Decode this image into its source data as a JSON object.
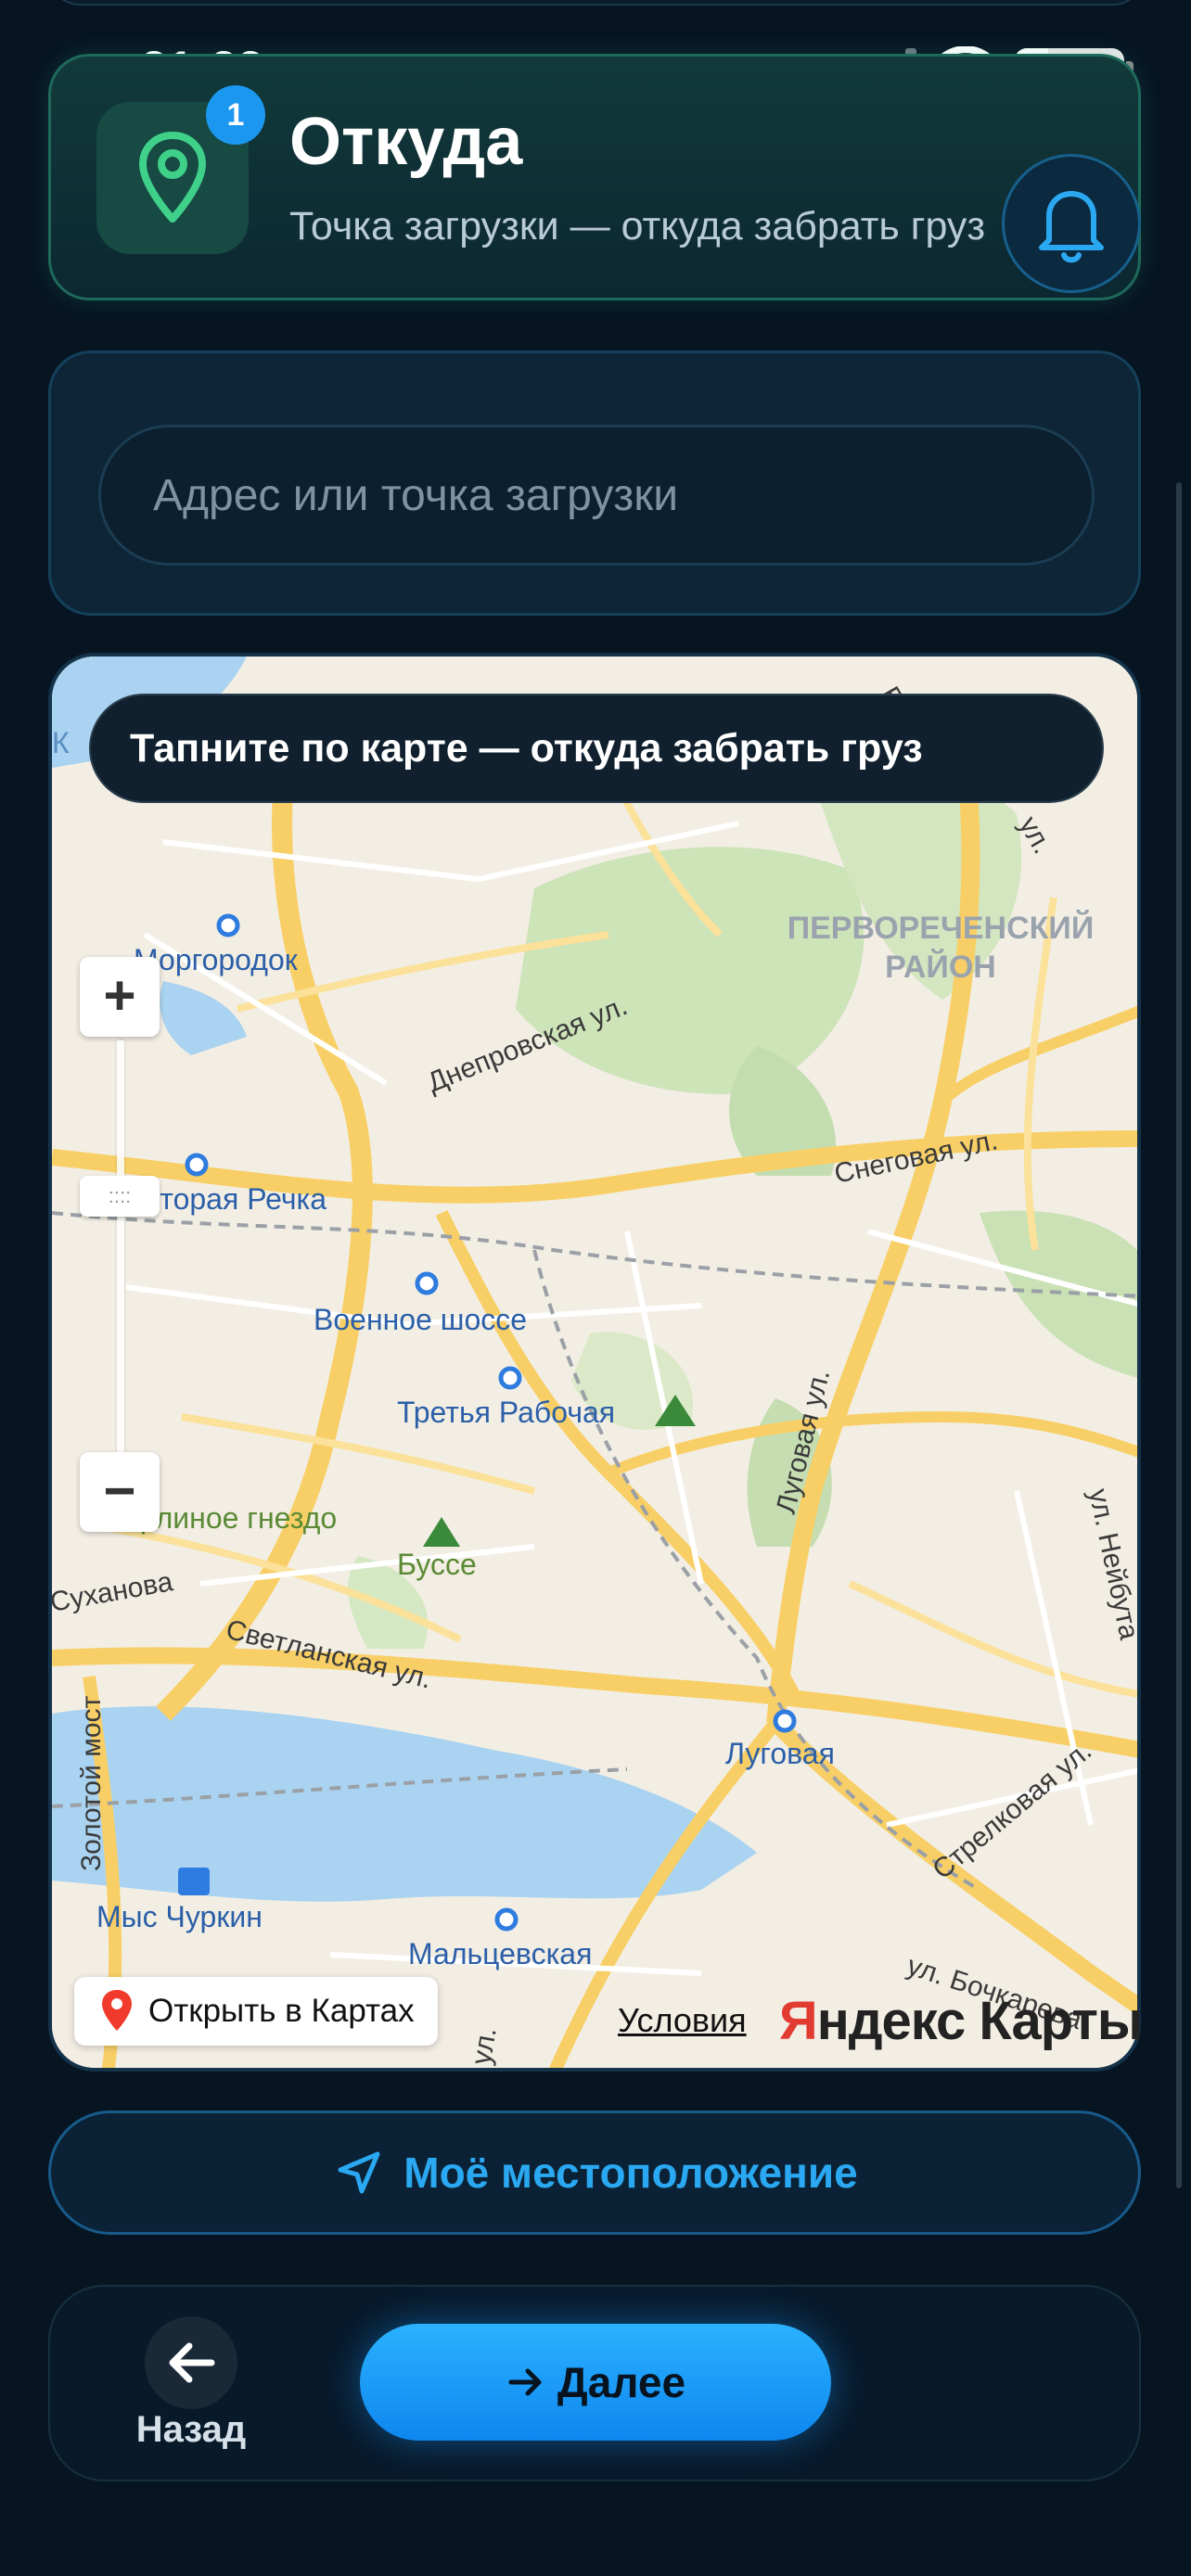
{
  "status_bar": {
    "time": "21:33",
    "battery": "29"
  },
  "header": {
    "badge_count": "1",
    "title": "Откуда",
    "subtitle": "Точка загрузки — откуда забрать груз"
  },
  "address": {
    "placeholder": "Адрес или точка загрузки"
  },
  "map": {
    "hint": "Тапните по карте — откуда забрать груз",
    "zoom_in": "+",
    "zoom_out": "−",
    "open_in_maps": "Открыть в Картах",
    "terms": "Условия",
    "brand_y": "Я",
    "brand_rest": "ндекс Карты",
    "labels": {
      "morgorodok": "Моргородок",
      "pervorechensky": "ПЕРВОРЕЧЕНСКИЙ",
      "raion": "РАЙОН",
      "dneprovskaya": "Днепровская ул.",
      "snegovaya": "Снеговая ул.",
      "vtoraya_rechka": "Вторая Речка",
      "voennoe_shosse": "Военное шоссе",
      "tretya_rabochaya": "Третья Рабочая",
      "lugovaya_ul": "Луговая ул.",
      "orlinoe": "Орлиное гнездо",
      "busse": "Буссе",
      "neyguta": "ул. Нейбута",
      "sukhanova": "Суханова",
      "svetlanskaya": "Светланская ул.",
      "zolotoy_most": "Золотой мост",
      "lugovaya": "Луговая",
      "strelkovaya": "Стрелковая ул.",
      "mys_churkin": "Мыс Чуркин",
      "maltsevskaya": "Мальцевская",
      "bochkareva": "ул. Бочкарева",
      "ul_top": "ул.",
      "ul_bottom": "ул.",
      "v_top": "В",
      "k_left": "К"
    }
  },
  "my_location_button": "Моё местоположение",
  "nav": {
    "back_label": "Назад",
    "next_label": "Далее"
  },
  "colors": {
    "accent": "#1c97ef",
    "pin_green": "#3fd08a",
    "background": "#071522"
  }
}
